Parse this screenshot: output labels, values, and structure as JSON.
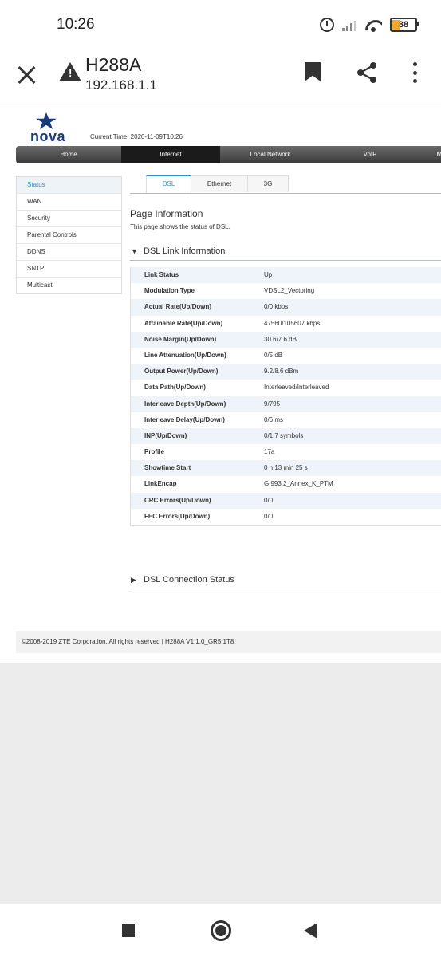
{
  "status_bar": {
    "time": "10:26",
    "battery": "38"
  },
  "browser": {
    "title": "H288A",
    "url": "192.168.1.1"
  },
  "router": {
    "logo_text": "nova",
    "current_time": "Current Time: 2020-11-09T10:26",
    "top_nav": [
      "Home",
      "Internet",
      "Local Network",
      "VoIP",
      "Ma"
    ],
    "top_nav_active": "Internet",
    "side_nav": [
      "Status",
      "WAN",
      "Security",
      "Parental Controls",
      "DDNS",
      "SNTP",
      "Multicast"
    ],
    "side_nav_active": "Status",
    "tabs": [
      "DSL",
      "Ethernet",
      "3G"
    ],
    "tab_active": "DSL",
    "page_info_title": "Page Information",
    "page_info_desc": "This page shows the status of DSL.",
    "dsl_link_section": "DSL Link Information",
    "dsl_link_arrow": "▼",
    "dsl_rows": [
      {
        "label": "Link Status",
        "value": "Up"
      },
      {
        "label": "Modulation Type",
        "value": "VDSL2_Vectoring"
      },
      {
        "label": "Actual Rate(Up/Down)",
        "value": "0/0 kbps"
      },
      {
        "label": "Attainable Rate(Up/Down)",
        "value": "47560/105607 kbps"
      },
      {
        "label": "Noise Margin(Up/Down)",
        "value": "30.6/7.6 dB"
      },
      {
        "label": "Line Attenuation(Up/Down)",
        "value": "0/5 dB"
      },
      {
        "label": "Output Power(Up/Down)",
        "value": "9.2/8.6 dBm"
      },
      {
        "label": "Data Path(Up/Down)",
        "value": "Interleaved/Interleaved"
      },
      {
        "label": "Interleave Depth(Up/Down)",
        "value": "9/795"
      },
      {
        "label": "Interleave Delay(Up/Down)",
        "value": "0/6 ms"
      },
      {
        "label": "INP(Up/Down)",
        "value": "0/1.7 symbols"
      },
      {
        "label": "Profile",
        "value": "17a"
      },
      {
        "label": "Showtime Start",
        "value": "0 h 13 min 25 s"
      },
      {
        "label": "LinkEncap",
        "value": "G.993.2_Annex_K_PTM"
      },
      {
        "label": "CRC Errors(Up/Down)",
        "value": "0/0"
      },
      {
        "label": "FEC Errors(Up/Down)",
        "value": "0/0"
      }
    ],
    "dsl_conn_section": "DSL Connection Status",
    "dsl_conn_arrow": "▶",
    "footer": "©2008-2019 ZTE Corporation. All rights reserved  |   H288A V1.1.0_GR5.1T8"
  },
  "colors": {
    "accent": "#2a8fcb",
    "logo": "#1a3a7a",
    "battery": "#f0a830"
  }
}
